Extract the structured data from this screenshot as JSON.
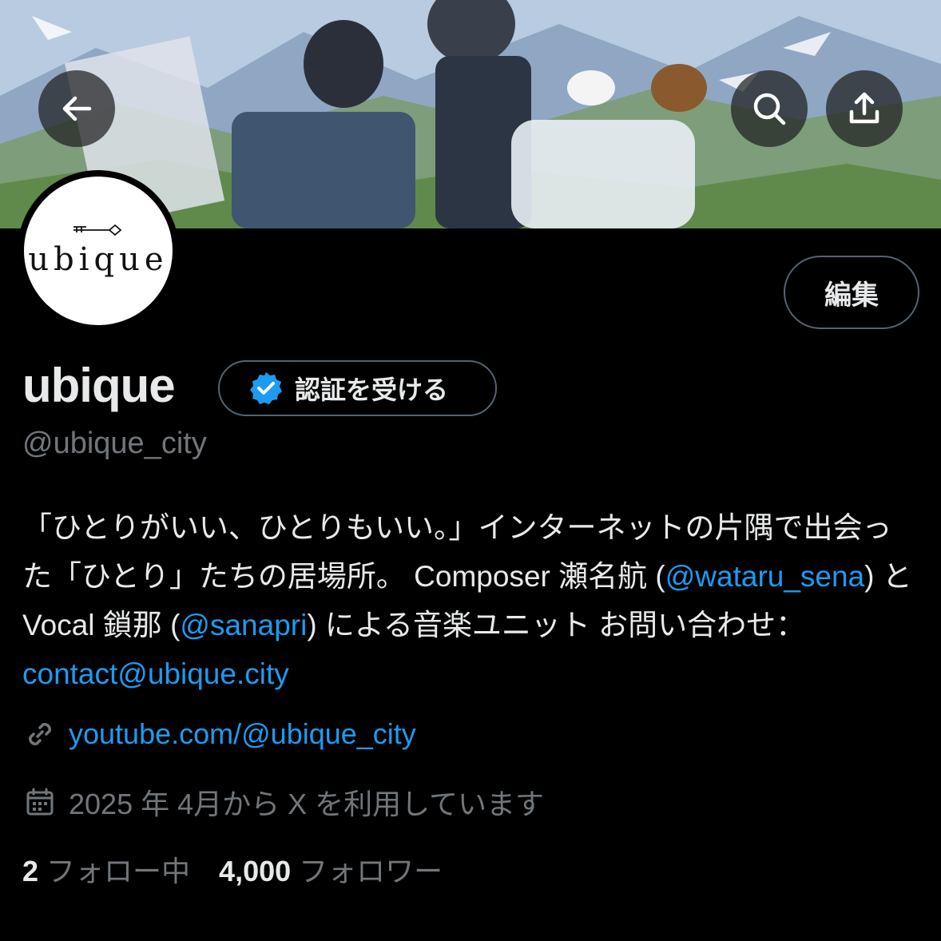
{
  "header": {
    "back_icon": "arrow-left-icon",
    "search_icon": "search-icon",
    "share_icon": "share-icon"
  },
  "avatar": {
    "logo_text": "ubique"
  },
  "edit_button": "編集",
  "profile": {
    "name": "ubique",
    "verify_label": "認証を受ける",
    "handle": "@ubique_city"
  },
  "bio": {
    "part1": "「ひとりがいい、ひとりもいい。」インターネットの片隅で出会った「ひとり」たちの居場所。 Composer 瀬名航 (",
    "mention1": "@wataru_sena",
    "part2": ") と Vocal 鎖那 (",
    "mention2": "@sanapri",
    "part3": ") による音楽ユニット お問い合わせ：",
    "email": "contact@ubique.city"
  },
  "website": "youtube.com/@ubique_city",
  "joined": "2025 年 4月から X を利用しています",
  "stats": {
    "following_count": "2",
    "following_label": "フォロー中",
    "followers_count": "4,000",
    "followers_label": "フォロワー"
  },
  "colors": {
    "accent": "#1d9bf0",
    "muted": "#71767b",
    "text": "#e7e9ea",
    "background": "#000000"
  }
}
